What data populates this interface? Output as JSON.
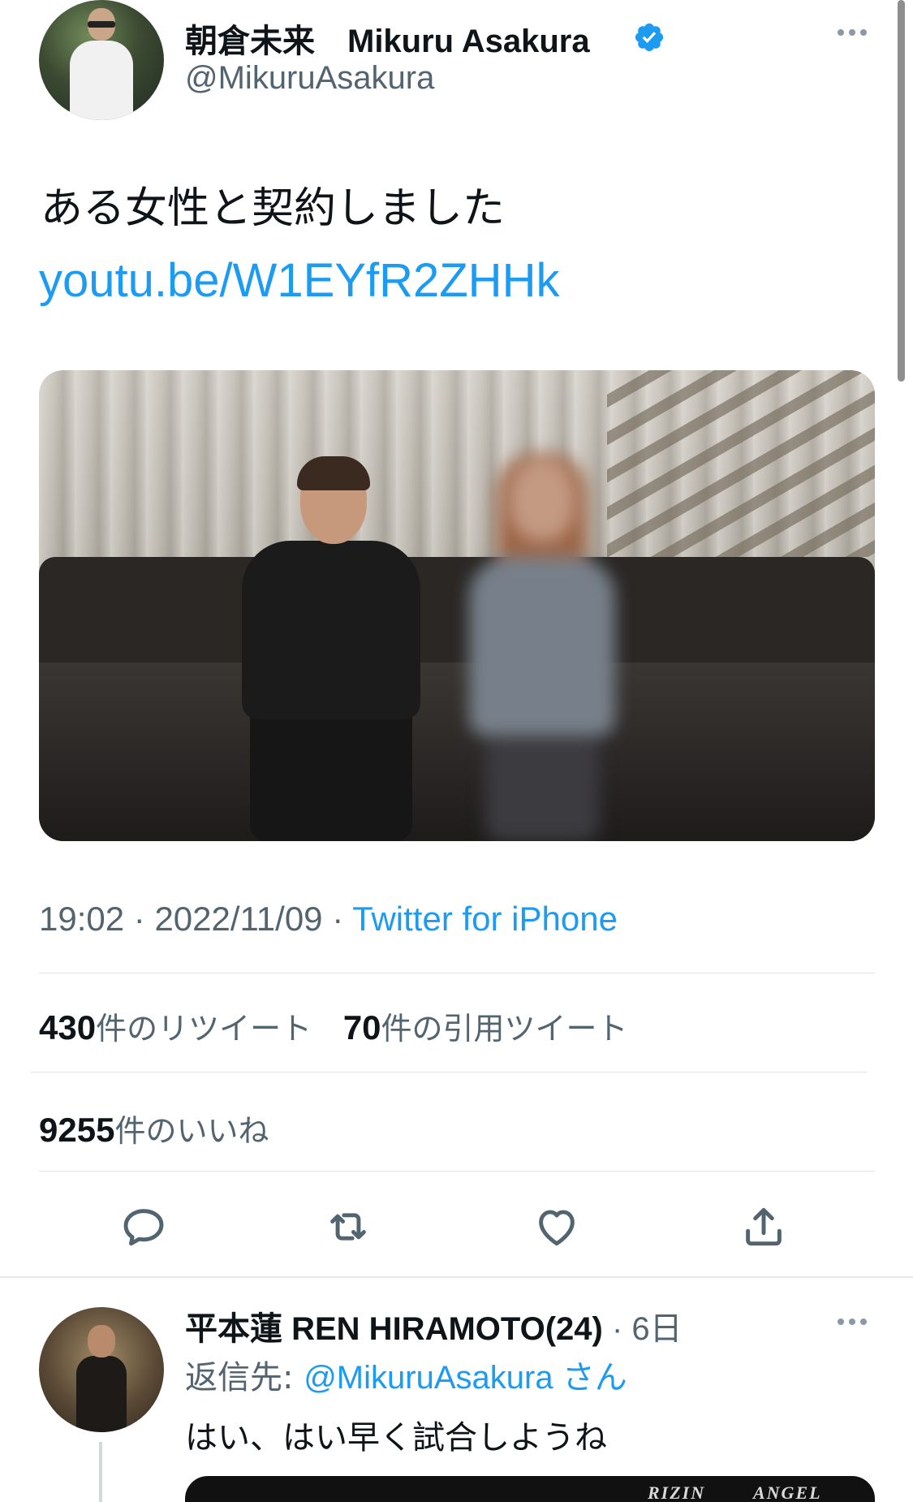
{
  "tweet": {
    "author_name": "朝倉未来　Mikuru Asakura",
    "author_handle": "@MikuruAsakura",
    "text": "ある女性と契約しました",
    "link": "youtu.be/W1EYfR2ZHHk",
    "time": "19:02",
    "date": "2022/11/09",
    "separator": "·",
    "source": "Twitter for iPhone",
    "stats": {
      "retweets": "430",
      "retweets_label": "件のリツイート",
      "quotes": "70",
      "quotes_label": "件の引用ツイート",
      "likes": "9255",
      "likes_label": "件のいいね"
    }
  },
  "reply": {
    "author_name": "平本蓮 REN HIRAMOTO(24)",
    "time": "· 6日",
    "reply_prefix": "返信先: ",
    "reply_to": "@MikuruAsakura",
    "reply_suffix": " さん",
    "text": "はい、はい早く試合しようね",
    "media_logos": [
      "RIZIN",
      "ANGEL"
    ]
  },
  "icons": {
    "verified": "verified-badge-icon",
    "more": "more-options-icon",
    "reply": "reply-icon",
    "retweet": "retweet-icon",
    "like": "heart-icon",
    "share": "share-icon"
  },
  "colors": {
    "accent": "#1d9bf0",
    "secondary_text": "#536471",
    "primary_text": "#0f1419"
  }
}
